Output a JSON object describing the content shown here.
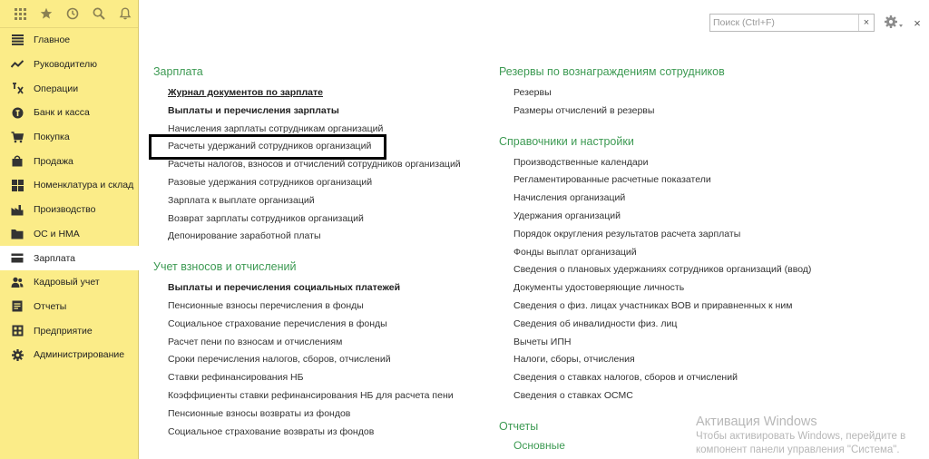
{
  "search": {
    "placeholder": "Поиск (Ctrl+F)",
    "clear": "×"
  },
  "close": "×",
  "nav": [
    {
      "label": "Главное",
      "icon": "menu-lines-icon"
    },
    {
      "label": "Руководителю",
      "icon": "trend-icon"
    },
    {
      "label": "Операции",
      "icon": "operations-icon"
    },
    {
      "label": "Банк и касса",
      "icon": "money-icon"
    },
    {
      "label": "Покупка",
      "icon": "cart-icon"
    },
    {
      "label": "Продажа",
      "icon": "bag-icon"
    },
    {
      "label": "Номенклатура и склад",
      "icon": "grid-icon"
    },
    {
      "label": "Производство",
      "icon": "factory-icon"
    },
    {
      "label": "ОС и НМА",
      "icon": "folder-icon"
    },
    {
      "label": "Зарплата",
      "icon": "card-icon"
    },
    {
      "label": "Кадровый учет",
      "icon": "people-icon"
    },
    {
      "label": "Отчеты",
      "icon": "report-icon"
    },
    {
      "label": "Предприятие",
      "icon": "enterprise-icon"
    },
    {
      "label": "Администрирование",
      "icon": "gear-icon"
    }
  ],
  "salary": {
    "title": "Зарплата",
    "items": [
      "Журнал документов по зарплате",
      "Выплаты и перечисления зарплаты",
      "Начисления зарплаты сотрудникам организаций",
      "Расчеты удержаний сотрудников организаций",
      "Расчеты налогов, взносов и отчислений сотрудников организаций",
      "Разовые удержания сотрудников организаций",
      "Зарплата к выплате организаций",
      "Возврат зарплаты сотрудников организаций",
      "Депонирование заработной платы"
    ]
  },
  "contrib": {
    "title": "Учет взносов и отчислений",
    "items": [
      "Выплаты и перечисления социальных платежей",
      "Пенсионные взносы перечисления в фонды",
      "Социальное страхование перечисления в фонды",
      "Расчет пени по взносам и отчислениям",
      "Сроки перечисления налогов, сборов, отчислений",
      "Ставки рефинансирования НБ",
      "Коэффициенты ставки рефинансирования НБ для расчета пени",
      "Пенсионные взносы возвраты из фондов",
      "Социальное страхование возвраты из фондов"
    ]
  },
  "reserves": {
    "title": "Резервы по вознаграждениям сотрудников",
    "items": [
      "Резервы",
      "Размеры отчислений в резервы"
    ]
  },
  "refs": {
    "title": "Справочники и настройки",
    "items": [
      "Производственные календари",
      "Регламентированные расчетные показатели",
      "Начисления организаций",
      "Удержания организаций",
      "Порядок округления результатов расчета зарплаты",
      "Фонды выплат организаций",
      "Сведения о плановых удержаниях сотрудников организаций (ввод)",
      "Документы удостоверяющие личность",
      "Сведения о физ. лицах участниках ВОВ и приравненных к ним",
      "Сведения об инвалидности физ. лиц",
      "Вычеты ИПН",
      "Налоги, сборы, отчисления",
      "Сведения о ставках налогов, сборов и отчислений",
      "Сведения о ставках ОСМС"
    ]
  },
  "reports": {
    "title": "Отчеты",
    "items": [
      "Основные"
    ]
  },
  "watermark": {
    "title": "Активация Windows",
    "line1": "Чтобы активировать Windows, перейдите в",
    "line2": "компонент панели управления \"Система\"."
  },
  "colors": {
    "sidebar": "#fbec88",
    "section_title": "#3d9a53",
    "highlight_border": "#000000"
  }
}
